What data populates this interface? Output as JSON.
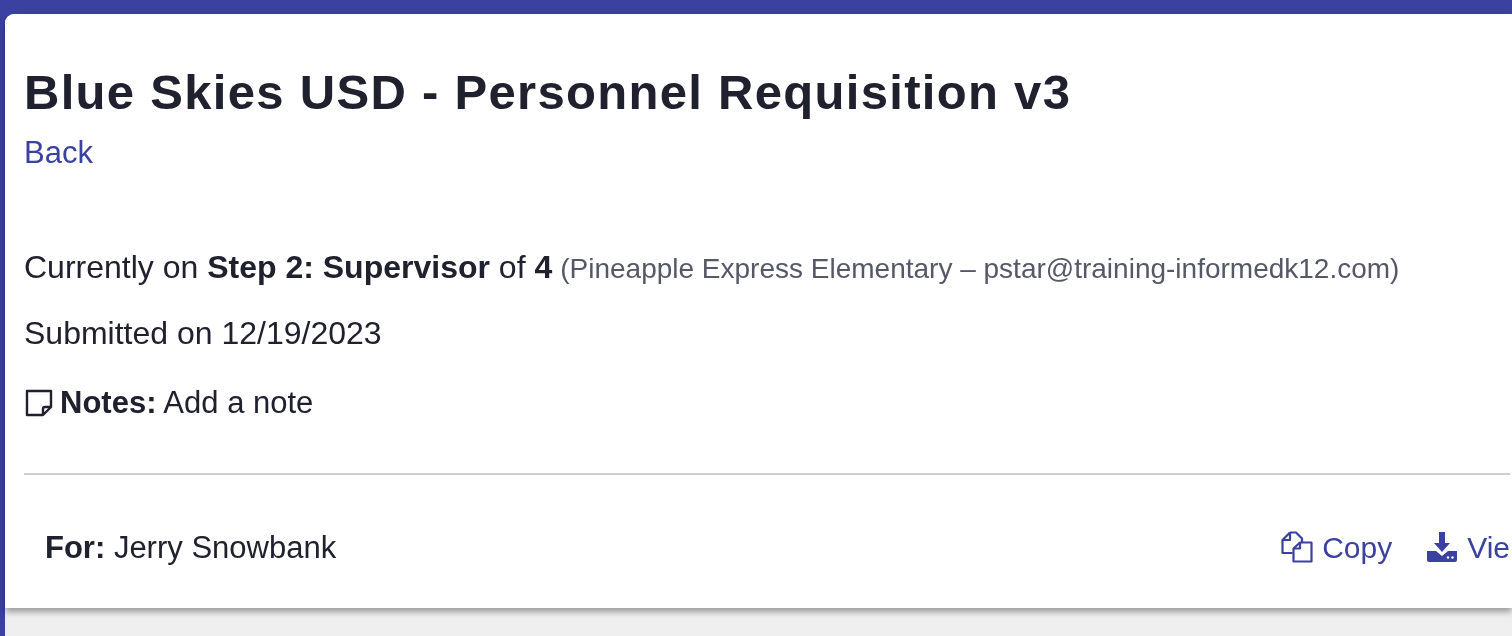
{
  "page": {
    "title": "Blue Skies USD - Personnel Requisition v3",
    "back_link": "Back"
  },
  "status": {
    "text": "Currently on **Step 2: Supervisor** of **4**",
    "detail": "(Pineapple Express Elementary – pstar@training-informedk12.com)"
  },
  "submitted": "Submitted on 12/19/2023",
  "notes": {
    "text": "**Notes:** Add a note"
  },
  "requester": "**For:** Jerry Snowbank",
  "actions": [
    {
      "kind": "copy",
      "label": "Copy"
    },
    {
      "kind": "download",
      "label": "Vie"
    }
  ]
}
